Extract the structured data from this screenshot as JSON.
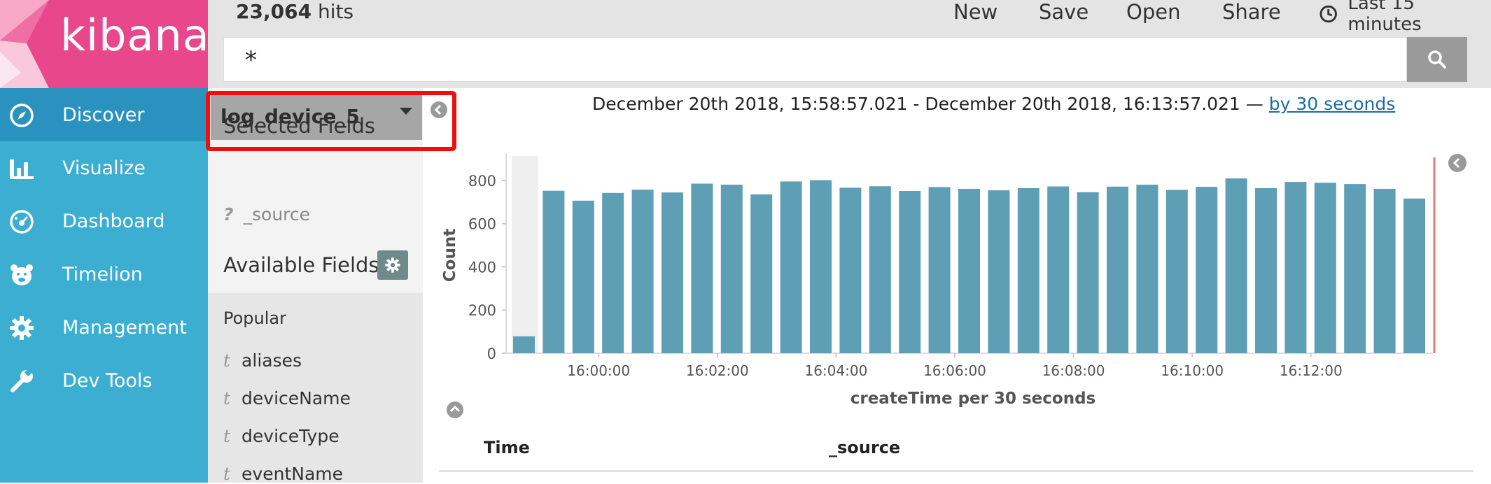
{
  "app": {
    "logo_text": "kibana"
  },
  "nav": {
    "items": [
      {
        "label": "Discover",
        "icon": "compass-icon",
        "active": true
      },
      {
        "label": "Visualize",
        "icon": "bar-chart-icon",
        "active": false
      },
      {
        "label": "Dashboard",
        "icon": "dashboard-gauge-icon",
        "active": false
      },
      {
        "label": "Timelion",
        "icon": "bear-icon",
        "active": false
      },
      {
        "label": "Management",
        "icon": "gear-icon",
        "active": false
      },
      {
        "label": "Dev Tools",
        "icon": "wrench-icon",
        "active": false
      }
    ]
  },
  "topbar": {
    "hits_count": "23,064",
    "hits_label": "hits",
    "menu": {
      "new": "New",
      "save": "Save",
      "open": "Open",
      "share": "Share"
    },
    "time_range": "Last 15 minutes"
  },
  "search": {
    "query": "*"
  },
  "sidebar": {
    "index_pattern": "log_device_5",
    "selected_fields_title": "Selected Fields",
    "source_field_type": "?",
    "source_field": "_source",
    "available_fields_title": "Available Fields",
    "popular_title": "Popular",
    "popular_fields": [
      {
        "type": "t",
        "name": "aliases"
      },
      {
        "type": "t",
        "name": "deviceName"
      },
      {
        "type": "t",
        "name": "deviceType"
      },
      {
        "type": "t",
        "name": "eventName"
      }
    ]
  },
  "main": {
    "range_text": "December 20th 2018, 15:58:57.021 - December 20th 2018, 16:13:57.021 —",
    "interval_link": "by 30 seconds"
  },
  "table": {
    "columns": [
      "Time",
      "_source"
    ]
  },
  "colors": {
    "bar": "#5e9fb6",
    "nav_bg": "#3caed2",
    "nav_active": "#2a92bf",
    "logo_bg": "#e8478b",
    "highlight": "#ee1010"
  },
  "chart_data": {
    "type": "bar",
    "ylabel": "Count",
    "xlabel": "createTime per 30 seconds",
    "ylim": [
      0,
      900
    ],
    "yticks": [
      0,
      200,
      400,
      600,
      800
    ],
    "xtick_labels": [
      "16:00:00",
      "16:02:00",
      "16:04:00",
      "16:06:00",
      "16:08:00",
      "16:10:00",
      "16:12:00"
    ],
    "x": [
      "15:58:30",
      "15:59:00",
      "15:59:30",
      "16:00:00",
      "16:00:30",
      "16:01:00",
      "16:01:30",
      "16:02:00",
      "16:02:30",
      "16:03:00",
      "16:03:30",
      "16:04:00",
      "16:04:30",
      "16:05:00",
      "16:05:30",
      "16:06:00",
      "16:06:30",
      "16:07:00",
      "16:07:30",
      "16:08:00",
      "16:08:30",
      "16:09:00",
      "16:09:30",
      "16:10:00",
      "16:10:30",
      "16:11:00",
      "16:11:30",
      "16:12:00",
      "16:12:30",
      "16:13:00",
      "16:13:30"
    ],
    "values": [
      78,
      752,
      706,
      742,
      757,
      744,
      785,
      780,
      735,
      795,
      801,
      766,
      773,
      751,
      769,
      761,
      754,
      764,
      772,
      745,
      771,
      780,
      756,
      770,
      809,
      764,
      793,
      789,
      783,
      761,
      716
    ]
  }
}
